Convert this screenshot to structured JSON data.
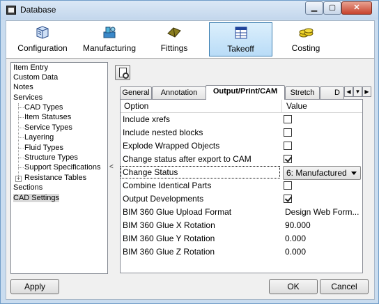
{
  "window": {
    "title": "Database",
    "min_glyph": "▁",
    "max_glyph": "▢",
    "close_glyph": "✕"
  },
  "toolbar": {
    "items": [
      {
        "label": "Configuration",
        "icon": "database-icon"
      },
      {
        "label": "Manufacturing",
        "icon": "machine-icon"
      },
      {
        "label": "Fittings",
        "icon": "fittings-icon"
      },
      {
        "label": "Takeoff",
        "icon": "takeoff-icon"
      },
      {
        "label": "Costing",
        "icon": "coins-icon"
      }
    ],
    "active": "Takeoff"
  },
  "sidebar": {
    "items": [
      {
        "label": "Item Entry"
      },
      {
        "label": "Custom Data"
      },
      {
        "label": "Notes"
      },
      {
        "label": "Services"
      },
      {
        "label": "CAD Types"
      },
      {
        "label": "Item Statuses"
      },
      {
        "label": "Service Types"
      },
      {
        "label": "Layering"
      },
      {
        "label": "Fluid Types"
      },
      {
        "label": "Structure Types"
      },
      {
        "label": "Support Specifications"
      },
      {
        "label": "Resistance Tables"
      },
      {
        "label": "Sections"
      },
      {
        "label": "CAD Settings"
      }
    ],
    "selected": "CAD Settings",
    "expander_glyph": "+",
    "collapse_glyph": "<"
  },
  "tabs": {
    "items": [
      "General",
      "Annotation",
      "Output/Print/CAM",
      "Stretch",
      "D"
    ],
    "active": "Output/Print/CAM",
    "nav": {
      "left": "◀",
      "menu": "▼",
      "right": "▶"
    }
  },
  "grid": {
    "col_option": "Option",
    "col_value": "Value",
    "rows": [
      {
        "label": "Include xrefs",
        "type": "checkbox",
        "checked": false
      },
      {
        "label": "Include nested blocks",
        "type": "checkbox",
        "checked": false
      },
      {
        "label": "Explode Wrapped Objects",
        "type": "checkbox",
        "checked": false
      },
      {
        "label": "Change status after export to CAM",
        "type": "checkbox",
        "checked": true
      },
      {
        "label": "Change Status",
        "type": "select",
        "value": "6: Manufactured"
      },
      {
        "label": "Combine Identical Parts",
        "type": "checkbox",
        "checked": false
      },
      {
        "label": "Output Developments",
        "type": "checkbox",
        "checked": true
      },
      {
        "label": "BIM 360 Glue Upload Format",
        "type": "text",
        "value": "Design Web Form..."
      },
      {
        "label": "BIM 360 Glue X Rotation",
        "type": "text",
        "value": "90.000"
      },
      {
        "label": "BIM 360 Glue Y Rotation",
        "type": "text",
        "value": "0.000"
      },
      {
        "label": "BIM 360 Glue Z Rotation",
        "type": "text",
        "value": "0.000"
      }
    ]
  },
  "buttons": {
    "apply": "Apply",
    "ok": "OK",
    "cancel": "Cancel"
  }
}
